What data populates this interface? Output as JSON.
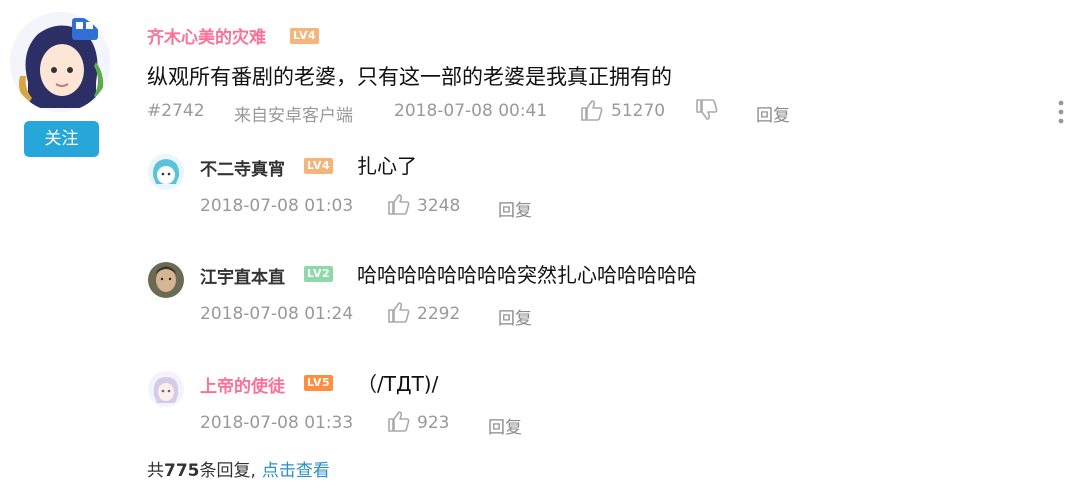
{
  "comment": {
    "username": "齐木心美的灾难",
    "level": "LV4",
    "text": "纵观所有番剧的老婆，只有这一部的老婆是我真正拥有的",
    "floor": "#2742",
    "source": "来自安卓客户端",
    "time": "2018-07-08 00:41",
    "likes": "51270",
    "reply_label": "回复",
    "follow_label": "关注"
  },
  "replies": [
    {
      "username": "不二寺真宵",
      "level": "LV4",
      "text": "扎心了",
      "time": "2018-07-08 01:03",
      "likes": "3248",
      "reply_label": "回复"
    },
    {
      "username": "江宇直本直",
      "level": "LV2",
      "text": "哈哈哈哈哈哈哈哈突然扎心哈哈哈哈哈",
      "time": "2018-07-08 01:24",
      "likes": "2292",
      "reply_label": "回复"
    },
    {
      "username": "上帝的使徒",
      "level": "LV5",
      "text": "（/TДT)/",
      "time": "2018-07-08 01:33",
      "likes": "923",
      "reply_label": "回复"
    }
  ],
  "footer": {
    "prefix": "共",
    "count": "775",
    "suffix": "条回复,",
    "link": "点击查看"
  },
  "colors": {
    "follow_bg": "#27a7d9",
    "vip_name": "#fb7299",
    "normal_name": "#333333",
    "lv4": "#f4b57a",
    "lv2": "#8fd9a8",
    "lv5": "#ff8f3f",
    "link": "#2a8fc8"
  },
  "icons": [
    "thumb-up-icon",
    "thumb-down-icon",
    "more-icon"
  ]
}
